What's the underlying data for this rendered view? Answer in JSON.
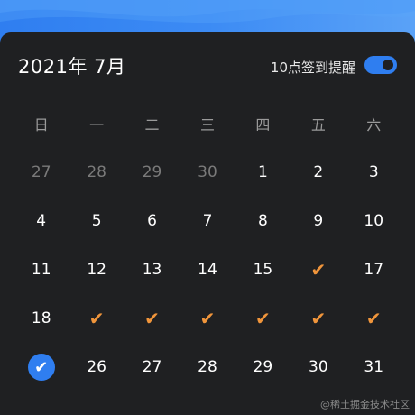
{
  "header": {
    "title": "2021年 7月",
    "reminder_label": "10点签到提醒",
    "reminder_enabled": true
  },
  "weekdays": [
    "日",
    "一",
    "二",
    "三",
    "四",
    "五",
    "六"
  ],
  "weeks": [
    [
      {
        "text": "27",
        "state": "muted"
      },
      {
        "text": "28",
        "state": "muted"
      },
      {
        "text": "29",
        "state": "muted"
      },
      {
        "text": "30",
        "state": "muted"
      },
      {
        "text": "1",
        "state": "normal"
      },
      {
        "text": "2",
        "state": "normal"
      },
      {
        "text": "3",
        "state": "normal"
      }
    ],
    [
      {
        "text": "4",
        "state": "normal"
      },
      {
        "text": "5",
        "state": "normal"
      },
      {
        "text": "6",
        "state": "normal"
      },
      {
        "text": "7",
        "state": "normal"
      },
      {
        "text": "8",
        "state": "normal"
      },
      {
        "text": "9",
        "state": "normal"
      },
      {
        "text": "10",
        "state": "normal"
      }
    ],
    [
      {
        "text": "11",
        "state": "normal"
      },
      {
        "text": "12",
        "state": "normal"
      },
      {
        "text": "13",
        "state": "normal"
      },
      {
        "text": "14",
        "state": "normal"
      },
      {
        "text": "15",
        "state": "normal"
      },
      {
        "text": "",
        "state": "checked"
      },
      {
        "text": "17",
        "state": "normal"
      }
    ],
    [
      {
        "text": "18",
        "state": "normal"
      },
      {
        "text": "",
        "state": "checked"
      },
      {
        "text": "",
        "state": "checked"
      },
      {
        "text": "",
        "state": "checked"
      },
      {
        "text": "",
        "state": "checked"
      },
      {
        "text": "",
        "state": "checked"
      },
      {
        "text": "",
        "state": "checked"
      }
    ],
    [
      {
        "text": "",
        "state": "today-checked"
      },
      {
        "text": "26",
        "state": "normal"
      },
      {
        "text": "27",
        "state": "normal"
      },
      {
        "text": "28",
        "state": "normal"
      },
      {
        "text": "29",
        "state": "normal"
      },
      {
        "text": "30",
        "state": "normal"
      },
      {
        "text": "31",
        "state": "normal"
      }
    ]
  ],
  "icons": {
    "checkmark": "✔"
  },
  "colors": {
    "accent": "#2f7ef0",
    "check": "#f0953b",
    "background": "#1f2022"
  },
  "watermark": "@稀土掘金技术社区"
}
